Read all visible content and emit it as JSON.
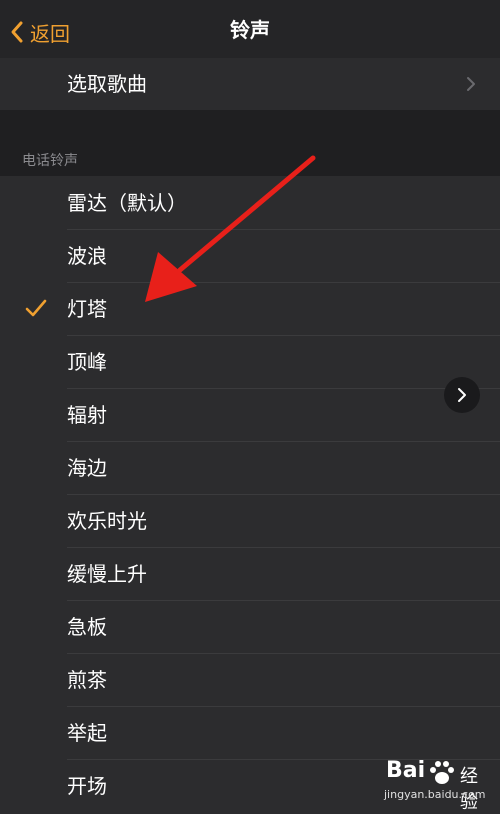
{
  "nav": {
    "back_label": "返回",
    "title": "铃声"
  },
  "pick_song": {
    "label": "选取歌曲"
  },
  "section": {
    "header": "电话铃声"
  },
  "ringtones": [
    {
      "label": "雷达（默认）",
      "selected": false
    },
    {
      "label": "波浪",
      "selected": false
    },
    {
      "label": "灯塔",
      "selected": true
    },
    {
      "label": "顶峰",
      "selected": false
    },
    {
      "label": "辐射",
      "selected": false
    },
    {
      "label": "海边",
      "selected": false
    },
    {
      "label": "欢乐时光",
      "selected": false
    },
    {
      "label": "缓慢上升",
      "selected": false
    },
    {
      "label": "急板",
      "selected": false
    },
    {
      "label": "煎茶",
      "selected": false
    },
    {
      "label": "举起",
      "selected": false
    },
    {
      "label": "开场",
      "selected": false
    }
  ],
  "watermark": {
    "logo": "Bai",
    "brand": "经验",
    "url": "jingyan.baidu.com"
  },
  "colors": {
    "accent": "#f0a030",
    "background": "#2c2c2e",
    "arrow": "#e8201a"
  }
}
